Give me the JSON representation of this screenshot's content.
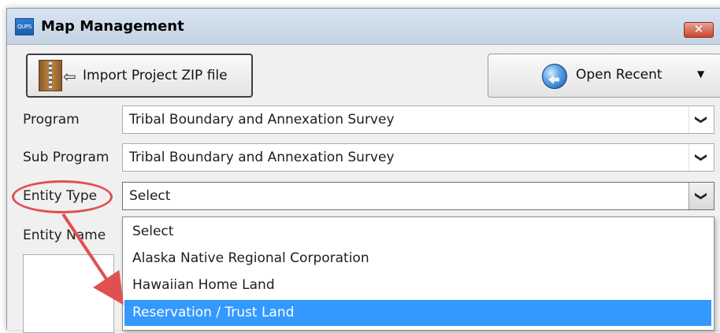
{
  "window": {
    "icon_text": "QUPS",
    "title": "Map Management",
    "close_glyph": "✕"
  },
  "toolbar": {
    "import_label": "Import Project ZIP file",
    "import_icon": "zip-file-icon",
    "open_recent_label": "Open Recent",
    "open_recent_icon": "globe-icon",
    "open_recent_caret": "▼"
  },
  "form": {
    "program_label": "Program",
    "program_value": "Tribal Boundary and Annexation Survey",
    "sub_program_label": "Sub Program",
    "sub_program_value": "Tribal Boundary and Annexation Survey",
    "entity_type_label": "Entity Type",
    "entity_type_value": "Select",
    "entity_name_label": "Entity Name",
    "caret": "❯"
  },
  "dropdown": {
    "options": [
      "Select",
      "Alaska Native Regional Corporation",
      "Hawaiian Home Land",
      "Reservation / Trust Land"
    ],
    "selected_index": 3
  },
  "colors": {
    "annotation": "#e05050",
    "selection": "#3399ff"
  }
}
